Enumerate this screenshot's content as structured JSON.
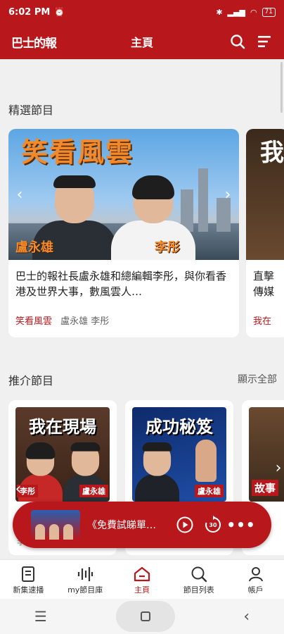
{
  "status": {
    "time": "6:02 PM",
    "battery": "71"
  },
  "header": {
    "logo": "巴士的報",
    "title": "主頁"
  },
  "featured": {
    "section_title": "精選節目",
    "cards": [
      {
        "image_title": "笑看風雲",
        "host_left": "盧永雄",
        "host_right": "李彤",
        "description": "巴士的報社長盧永雄和總編輯李彤，與你看香港及世界大事，數風雲人…",
        "series": "笑看風雲",
        "hosts": "盧永雄 李彤"
      },
      {
        "image_title": "我",
        "description_line1": "直擊",
        "description_line2": "傳媒",
        "series": "我在"
      }
    ]
  },
  "recommended": {
    "section_title": "推介節目",
    "show_all": "顯示全部",
    "cards": [
      {
        "image_title": "我在現場",
        "host_left": "李彤",
        "host_right": "盧永雄",
        "below": "李"
      },
      {
        "image_title": "成功秘笈",
        "host": "盧永雄"
      },
      {
        "image_title": "故事"
      }
    ]
  },
  "player": {
    "title": "《免費試睇單…",
    "skip_seconds": "30"
  },
  "nav": {
    "items": [
      {
        "label": "新集速播",
        "icon": "document-icon"
      },
      {
        "label": "my節目庫",
        "icon": "audio-bars-icon"
      },
      {
        "label": "主頁",
        "icon": "home-icon",
        "active": true
      },
      {
        "label": "節目列表",
        "icon": "search-list-icon"
      },
      {
        "label": "帳戶",
        "icon": "person-icon"
      }
    ]
  },
  "colors": {
    "brand_red": "#b8181c",
    "accent_orange": "#f28a2b"
  }
}
